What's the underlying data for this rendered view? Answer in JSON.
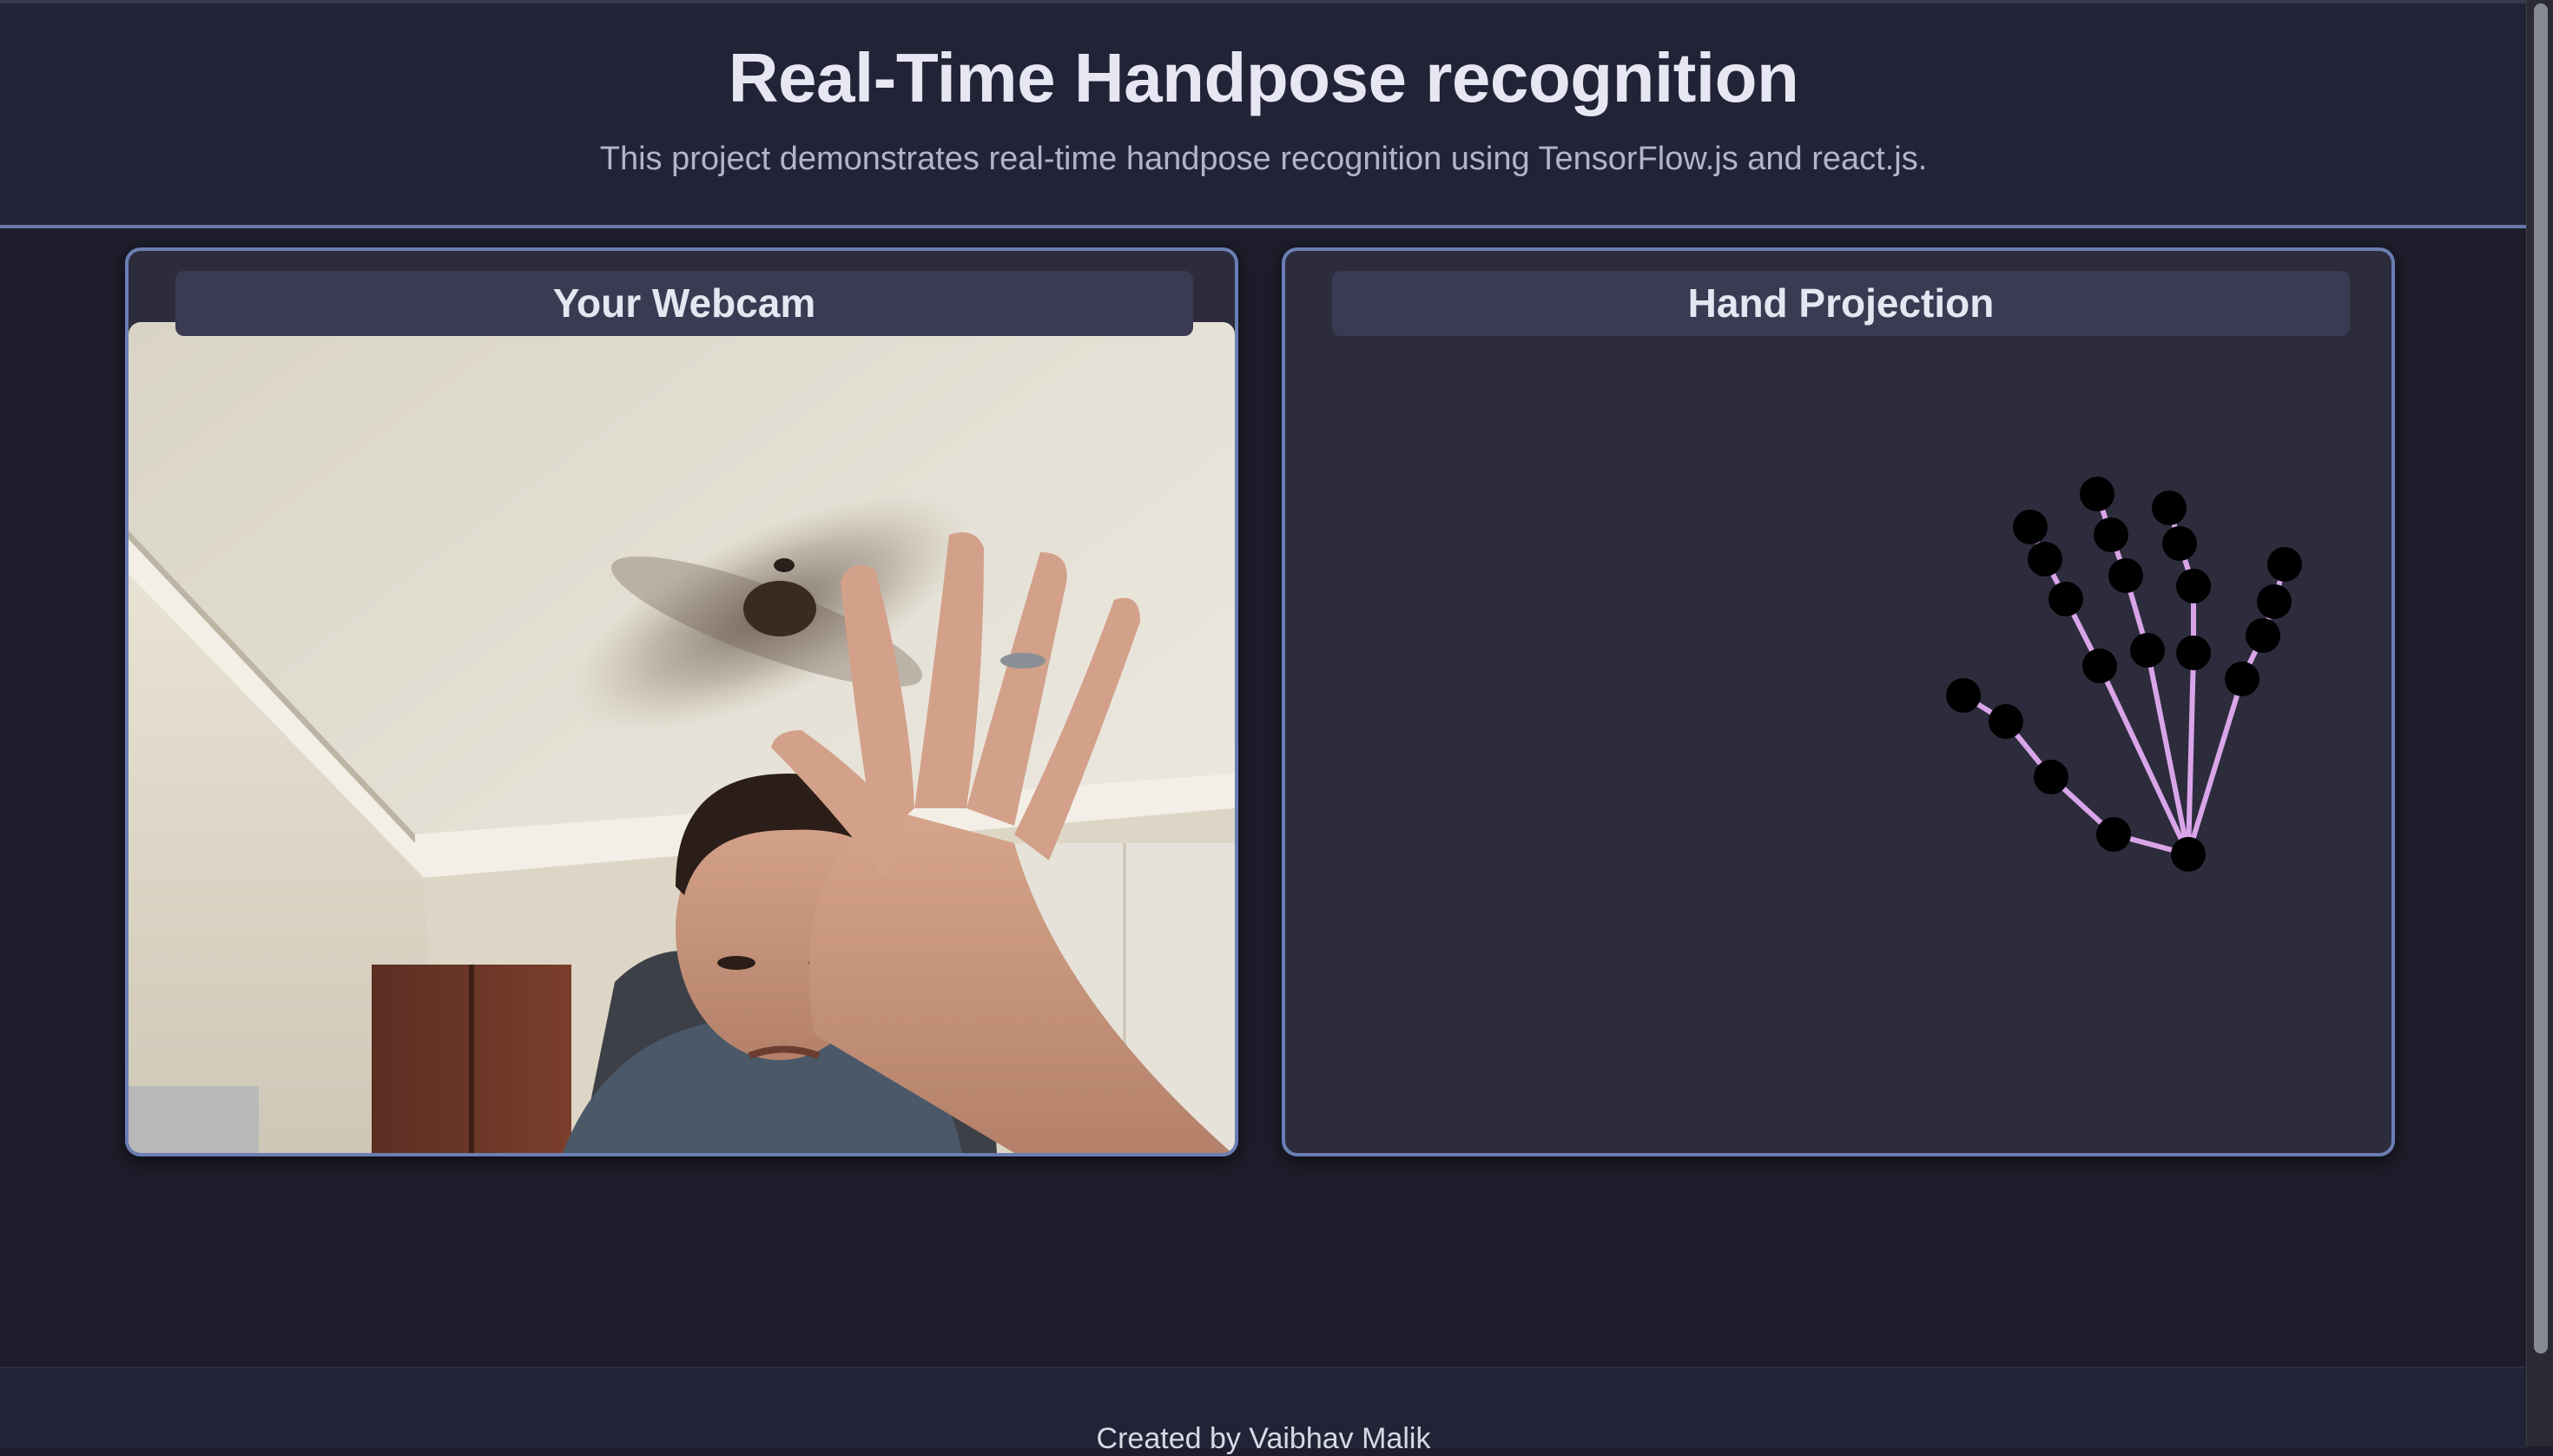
{
  "header": {
    "title": "Real-Time Handpose recognition",
    "subtitle": "This project demonstrates real-time handpose recognition using TensorFlow.js and react.js."
  },
  "webcam_panel": {
    "title": "Your Webcam"
  },
  "projection_panel": {
    "title": "Hand Projection"
  },
  "footer": {
    "text": "Created by Vaibhav Malik"
  },
  "colors": {
    "background": "#1d1d2b",
    "header_bg": "#232338",
    "panel_bg": "#2c2c3d",
    "panel_border": "#6b7fb4",
    "skeleton_line": "#d9a5e8",
    "keypoint": "#000000"
  },
  "icons": [
    "hand-skeleton"
  ]
}
